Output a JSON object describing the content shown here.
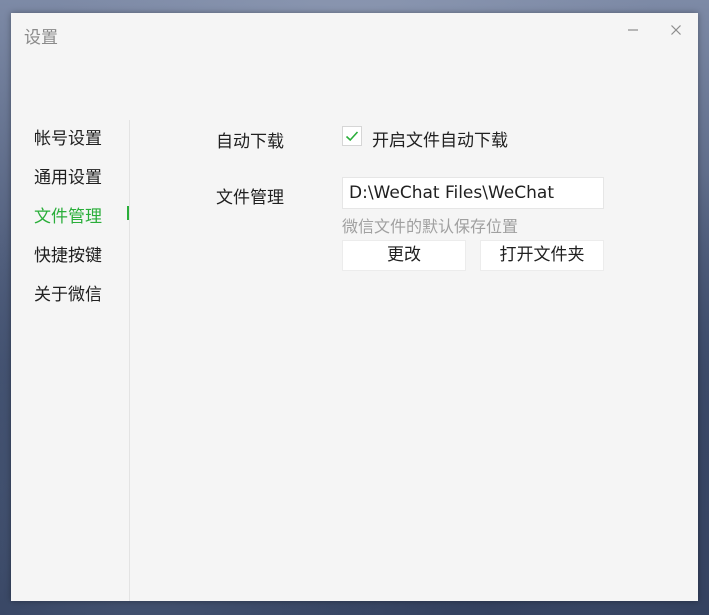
{
  "window": {
    "title": "设置"
  },
  "icons": {
    "minimize": "minimize-icon",
    "close": "close-icon",
    "check": "checkmark-icon"
  },
  "colors": {
    "accent": "#2aae3a",
    "window_bg": "#f5f5f5",
    "hint_text": "#a0a0a0"
  },
  "sidebar": {
    "active_index": 2,
    "items": [
      {
        "label": "帐号设置"
      },
      {
        "label": "通用设置"
      },
      {
        "label": "文件管理"
      },
      {
        "label": "快捷按键"
      },
      {
        "label": "关于微信"
      }
    ]
  },
  "content": {
    "auto_download": {
      "label": "自动下载",
      "checkbox_label": "开启文件自动下载",
      "checked": true
    },
    "file_management": {
      "label": "文件管理",
      "path": "D:\\WeChat Files\\WeChat",
      "hint": "微信文件的默认保存位置",
      "change_button": "更改",
      "open_folder_button": "打开文件夹"
    }
  }
}
